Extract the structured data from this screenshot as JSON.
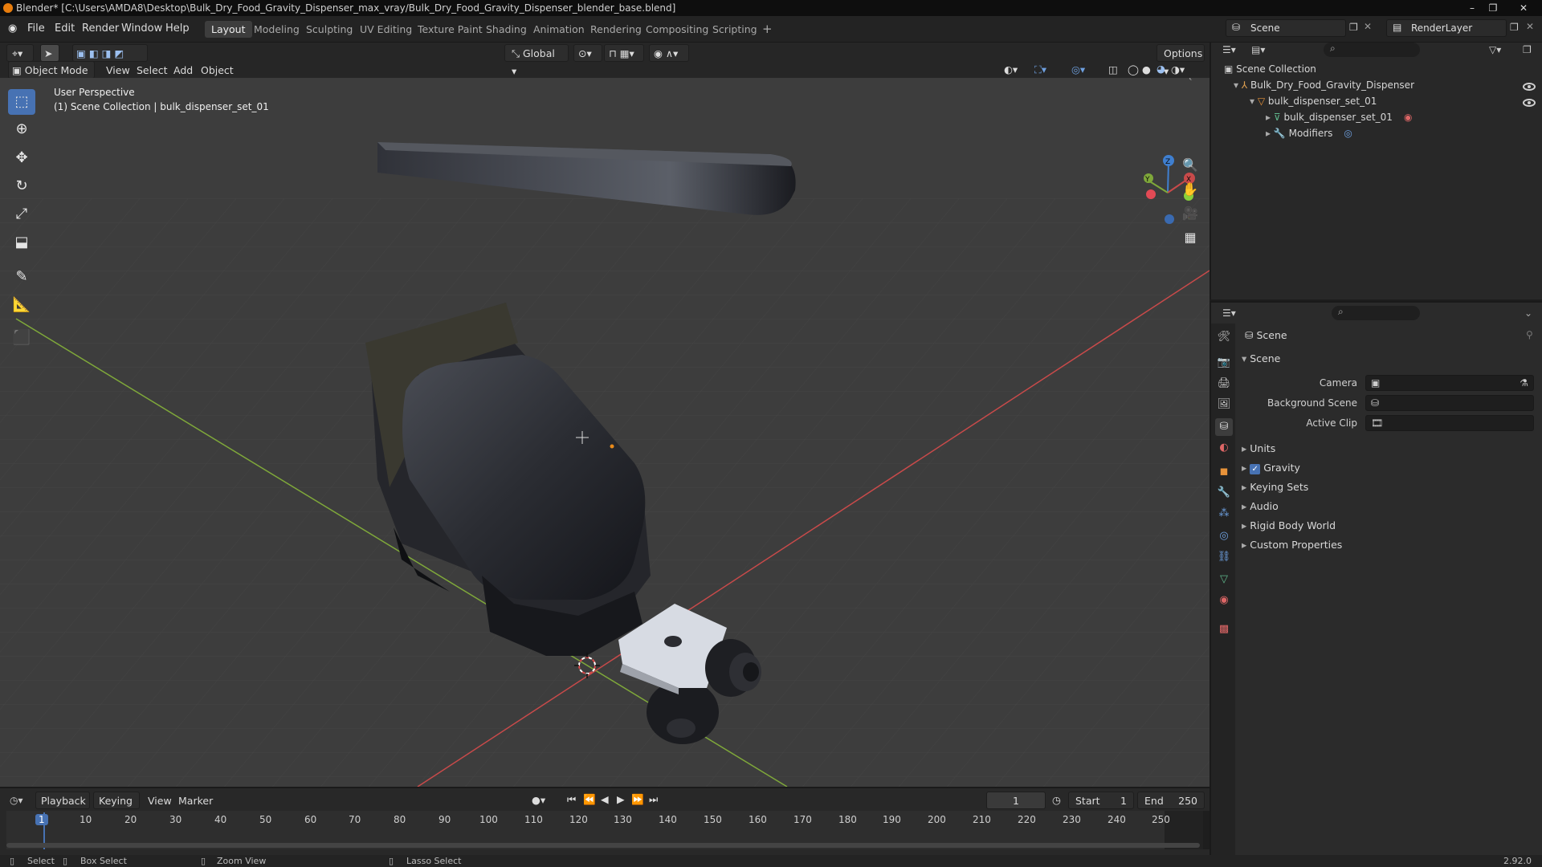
{
  "window": {
    "title": "Blender* [C:\\Users\\AMDA8\\Desktop\\Bulk_Dry_Food_Gravity_Dispenser_max_vray/Bulk_Dry_Food_Gravity_Dispenser_blender_base.blend]",
    "controls": [
      "–",
      "❐",
      "✕"
    ]
  },
  "menu": [
    "File",
    "Edit",
    "Render",
    "Window",
    "Help"
  ],
  "workspaces": [
    "Layout",
    "Modeling",
    "Sculpting",
    "UV Editing",
    "Texture Paint",
    "Shading",
    "Animation",
    "Rendering",
    "Compositing",
    "Scripting"
  ],
  "add_workspace": "+",
  "scene_selector": "Scene",
  "renderlayer_selector": "RenderLayer",
  "viewport_header": {
    "transform_orientation": "Global",
    "options": "Options",
    "mode": "Object Mode",
    "menus": [
      "View",
      "Select",
      "Add",
      "Object"
    ]
  },
  "viewport": {
    "perspective_label": "User Perspective",
    "collection_label": "(1) Scene Collection | bulk_dispenser_set_01",
    "gizmo_axes": [
      "X",
      "Y",
      "Z"
    ]
  },
  "tools": [
    "select-box",
    "cursor",
    "move",
    "rotate",
    "scale",
    "transform",
    "annotate",
    "measure",
    "add-cube"
  ],
  "nav": [
    "zoom-icon",
    "hand-icon",
    "camera-icon",
    "grid-icon"
  ],
  "outliner": {
    "root": "Scene Collection",
    "items": [
      {
        "label": "Bulk_Dry_Food_Gravity_Dispenser",
        "indent": 0
      },
      {
        "label": "bulk_dispenser_set_01",
        "indent": 1
      },
      {
        "label": "bulk_dispenser_set_01",
        "indent": 2
      },
      {
        "label": "Modifiers",
        "indent": 2
      }
    ]
  },
  "properties": {
    "context": "Scene",
    "panel": "Scene",
    "fields": [
      {
        "label": "Camera",
        "value": ""
      },
      {
        "label": "Background Scene",
        "value": ""
      },
      {
        "label": "Active Clip",
        "value": ""
      }
    ],
    "sections": [
      "Units",
      "Gravity",
      "Keying Sets",
      "Audio",
      "Rigid Body World",
      "Custom Properties"
    ],
    "gravity_checked": true
  },
  "timeline": {
    "menus": [
      "Playback",
      "Keying",
      "View",
      "Marker"
    ],
    "current_frame": "1",
    "start_label": "Start",
    "start": "1",
    "end_label": "End",
    "end": "250",
    "ticks": [
      "1",
      "10",
      "20",
      "30",
      "40",
      "50",
      "60",
      "70",
      "80",
      "90",
      "100",
      "110",
      "120",
      "130",
      "140",
      "150",
      "160",
      "170",
      "180",
      "190",
      "200",
      "210",
      "220",
      "230",
      "240",
      "250"
    ]
  },
  "status": {
    "select": "Select",
    "box_select": "Box Select",
    "zoom_view": "Zoom View",
    "lasso_select": "Lasso Select",
    "version": "2.92.0"
  },
  "colors": {
    "accent": "#4772b3",
    "x_axis": "#c84a4a",
    "y_axis": "#7fa83a",
    "z_axis": "#3f7fd0",
    "viewport_bg": "#3d3d3d"
  }
}
